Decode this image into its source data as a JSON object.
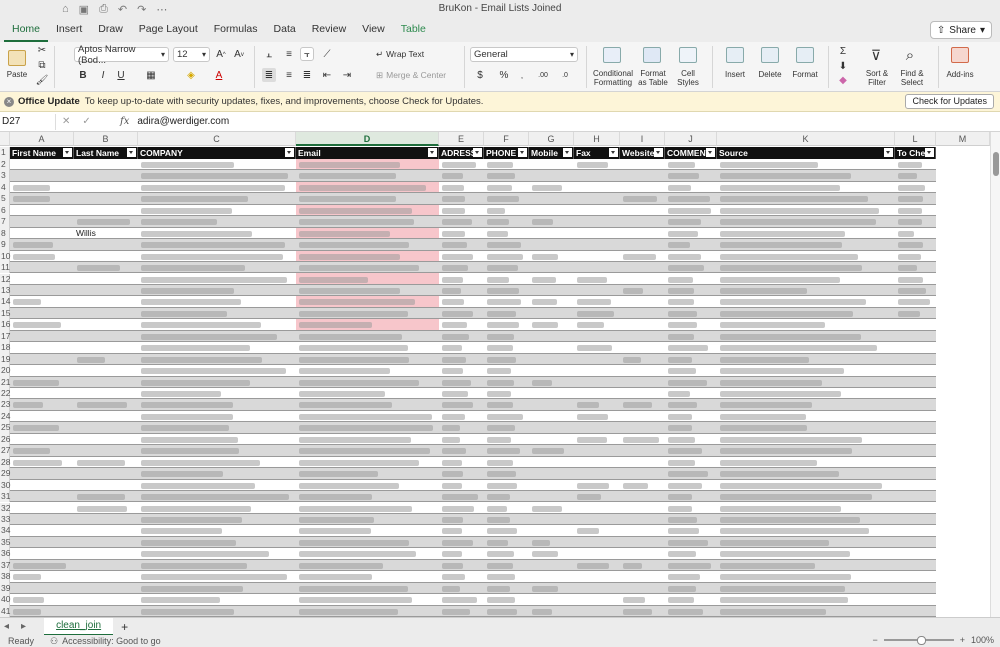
{
  "window": {
    "title": "BruKon - Email Lists Joined"
  },
  "menu_tabs": [
    "Home",
    "Insert",
    "Draw",
    "Page Layout",
    "Formulas",
    "Data",
    "Review",
    "View",
    "Table"
  ],
  "share_label": "Share",
  "ribbon": {
    "paste": "Paste",
    "font_name": "Aptos Narrow (Bod...",
    "font_size": "12",
    "bold": "B",
    "italic": "I",
    "underline": "U",
    "wrap_text": "Wrap Text",
    "merge_center": "Merge & Center",
    "number_format": "General",
    "currency": "$",
    "percent": "%",
    "conditional_formatting": "Conditional Formatting",
    "format_as_table": "Format as Table",
    "cell_styles": "Cell Styles",
    "insert": "Insert",
    "delete": "Delete",
    "format": "Format",
    "sort_filter": "Sort & Filter",
    "find_select": "Find & Select",
    "addins": "Add-ins"
  },
  "update_bar": {
    "title": "Office Update",
    "message": "To keep up-to-date with security updates, fixes, and improvements, choose Check for Updates.",
    "button": "Check for Updates"
  },
  "formula_bar": {
    "name_box": "D27",
    "fx": "fx",
    "value": "adira@werdiger.com"
  },
  "columns": [
    "A",
    "B",
    "C",
    "D",
    "E",
    "F",
    "G",
    "H",
    "I",
    "J",
    "K",
    "L",
    "M"
  ],
  "selected_column": "D",
  "table_headers": [
    "First Name",
    "Last Name",
    "COMPANY",
    "Email",
    "ADRESS",
    "PHONE",
    "Mobile",
    "Fax",
    "Website",
    "COMMENT",
    "Source",
    "To Chec"
  ],
  "rows": [
    {
      "num": "2",
      "a": "",
      "b": ""
    },
    {
      "num": "3",
      "a": "",
      "b": ""
    },
    {
      "num": "4",
      "a": "",
      "b": ""
    },
    {
      "num": "5",
      "a": "",
      "b": ""
    },
    {
      "num": "6",
      "a": "",
      "b": ""
    },
    {
      "num": "7",
      "a": "",
      "b": ""
    },
    {
      "num": "8",
      "a": "",
      "b": "Willis"
    },
    {
      "num": "9",
      "a": "",
      "b": ""
    },
    {
      "num": "10",
      "a": "",
      "b": ""
    },
    {
      "num": "11",
      "a": "",
      "b": ""
    },
    {
      "num": "12",
      "a": "",
      "b": ""
    },
    {
      "num": "13",
      "a": "",
      "b": ""
    },
    {
      "num": "14",
      "a": "",
      "b": ""
    },
    {
      "num": "15",
      "a": "",
      "b": ""
    },
    {
      "num": "16",
      "a": "",
      "b": ""
    },
    {
      "num": "17",
      "a": "",
      "b": ""
    },
    {
      "num": "18",
      "a": "",
      "b": ""
    },
    {
      "num": "19",
      "a": "",
      "b": ""
    },
    {
      "num": "20",
      "a": "",
      "b": ""
    },
    {
      "num": "21",
      "a": "",
      "b": ""
    },
    {
      "num": "22",
      "a": "",
      "b": ""
    },
    {
      "num": "23",
      "a": "",
      "b": ""
    },
    {
      "num": "24",
      "a": "",
      "b": ""
    },
    {
      "num": "25",
      "a": "",
      "b": ""
    },
    {
      "num": "26",
      "a": "",
      "b": ""
    },
    {
      "num": "27",
      "a": "",
      "b": ""
    },
    {
      "num": "28",
      "a": "",
      "b": ""
    },
    {
      "num": "29",
      "a": "",
      "b": ""
    },
    {
      "num": "30",
      "a": "",
      "b": ""
    },
    {
      "num": "31",
      "a": "",
      "b": ""
    },
    {
      "num": "32",
      "a": "",
      "b": ""
    },
    {
      "num": "33",
      "a": "",
      "b": ""
    },
    {
      "num": "34",
      "a": "",
      "b": ""
    },
    {
      "num": "35",
      "a": "",
      "b": ""
    },
    {
      "num": "36",
      "a": "",
      "b": ""
    },
    {
      "num": "37",
      "a": "",
      "b": ""
    },
    {
      "num": "38",
      "a": "",
      "b": ""
    },
    {
      "num": "39",
      "a": "",
      "b": ""
    },
    {
      "num": "40",
      "a": "",
      "b": ""
    },
    {
      "num": "41",
      "a": "",
      "b": ""
    },
    {
      "num": "42",
      "a": "",
      "b": ""
    }
  ],
  "sheet_tab": "clean_join",
  "status": {
    "ready": "Ready",
    "accessibility": "Accessibility: Good to go",
    "zoom": "100%"
  },
  "colors": {
    "accent": "#1e6e3c",
    "highlight": "#f7c6cb",
    "band": "#d9d9d9",
    "header_bg": "#111111"
  }
}
